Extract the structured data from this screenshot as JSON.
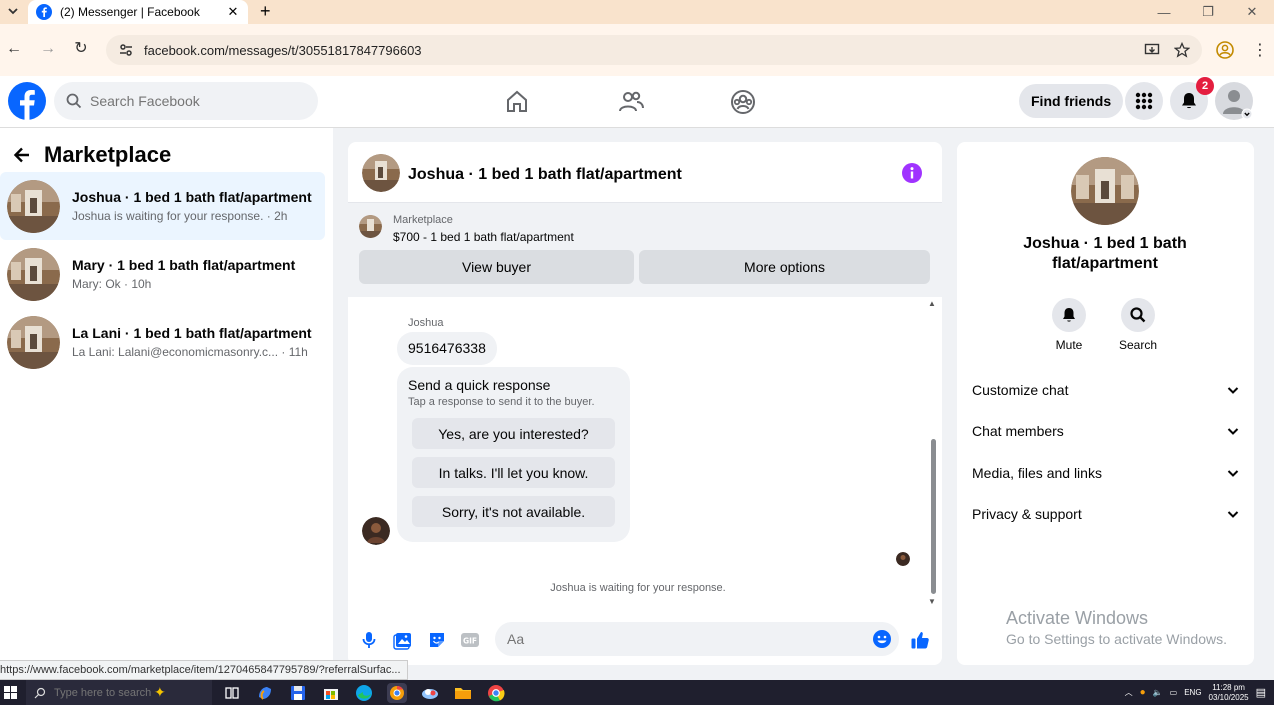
{
  "browser": {
    "tab_title": "(2) Messenger | Facebook",
    "url": "facebook.com/messages/t/30551817847796603",
    "status_url": "https://www.facebook.com/marketplace/item/1270465847795789/?referralSurfac..."
  },
  "header": {
    "search_placeholder": "Search Facebook",
    "find_friends": "Find friends",
    "notifications_count": "2"
  },
  "sidebar": {
    "title": "Marketplace",
    "conversations": [
      {
        "name": "Joshua · 1 bed 1 bath flat/apartment",
        "preview": "Joshua is waiting for your response. · 2h"
      },
      {
        "name": "Mary · 1 bed 1 bath flat/apartment",
        "preview": "Mary: Ok · 10h"
      },
      {
        "name": "La Lani · 1 bed 1 bath flat/apartment",
        "preview": "La Lani: Lalani@economicmasonry.c...  · 11h"
      }
    ]
  },
  "chat": {
    "title": "Joshua · 1 bed 1 bath flat/apartment",
    "marketplace_label": "Marketplace",
    "listing": "$700 - 1 bed 1 bath flat/apartment",
    "view_buyer": "View buyer",
    "more_options": "More options",
    "sender": "Joshua",
    "phone_message": "9516476338",
    "quick_response_title": "Send a quick response",
    "quick_response_sub": "Tap a response to send it to the buyer.",
    "quick_responses": [
      "Yes, are you interested?",
      "In talks. I'll let you know.",
      "Sorry, it's not available."
    ],
    "waiting_note": "Joshua is waiting for your response.",
    "composer_placeholder": "Aa"
  },
  "details": {
    "name": "Joshua · 1 bed 1 bath flat/apartment",
    "mute": "Mute",
    "search": "Search",
    "sections": [
      "Customize chat",
      "Chat members",
      "Media, files and links",
      "Privacy & support"
    ]
  },
  "watermark": {
    "line1": "Activate Windows",
    "line2": "Go to Settings to activate Windows."
  },
  "taskbar": {
    "search_placeholder": "Type here to search",
    "lang": "ENG",
    "time": "11:28 pm",
    "date": "03/10/2025"
  },
  "colors": {
    "facebook_blue": "#0866ff",
    "messenger_purple": "#a033ff",
    "active_row": "#ebf5ff"
  }
}
